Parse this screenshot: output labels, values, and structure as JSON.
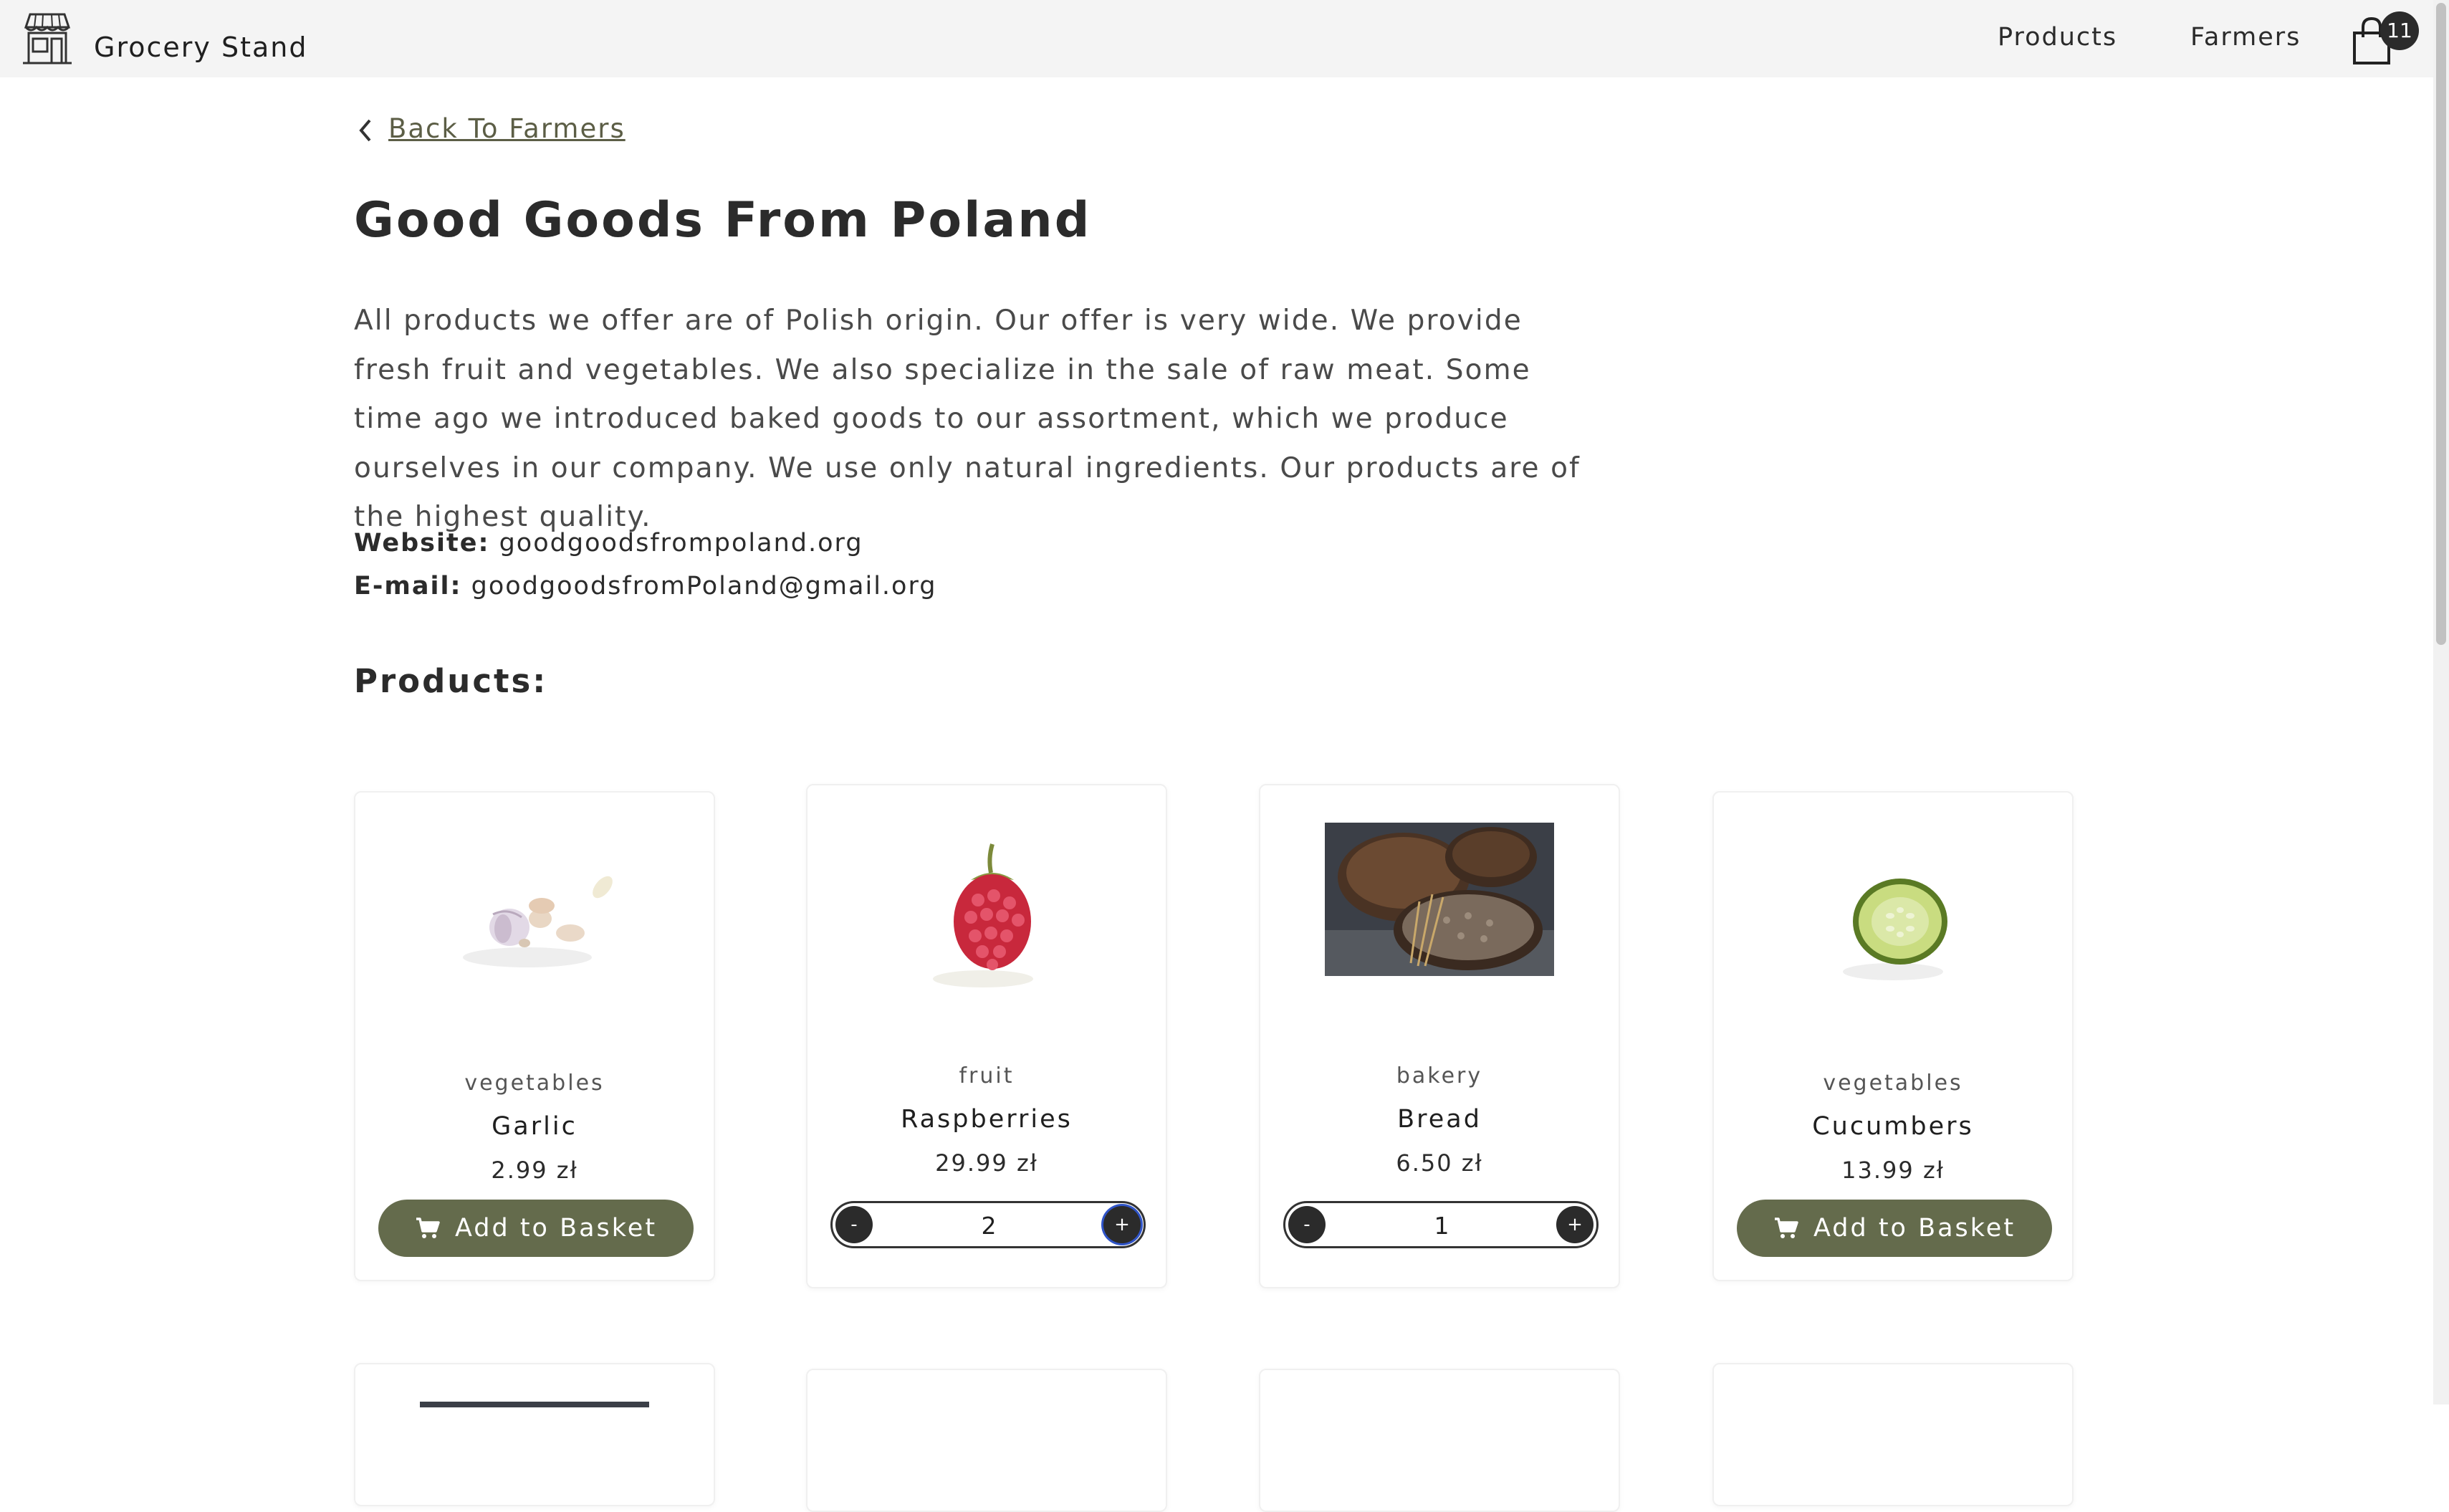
{
  "header": {
    "brand": "Grocery Stand",
    "nav": {
      "products": "Products",
      "farmers": "Farmers"
    },
    "cart_count": "11"
  },
  "back_link": "Back To Farmers",
  "farmer": {
    "title": "Good Goods From Poland",
    "description": "All products we offer are of Polish origin. Our offer is very wide. We provide fresh fruit and vegetables. We also specialize in the sale of raw meat. Some time ago we introduced baked goods to our assortment, which we produce ourselves in our company. We use only natural ingredients. Our products are of the highest quality.",
    "website_label": "Website:",
    "website": "goodgoodsfrompoland.org",
    "email_label": "E-mail:",
    "email": "goodgoodsfromPoland@gmail.org"
  },
  "products_heading": "Products:",
  "products": [
    {
      "category": "vegetables",
      "name": "Garlic",
      "price": "2.99 zł",
      "action": "Add to Basket",
      "image": "garlic-image"
    },
    {
      "category": "fruit",
      "name": "Raspberries",
      "price": "29.99 zł",
      "quantity": "2",
      "image": "raspberry-image"
    },
    {
      "category": "bakery",
      "name": "Bread",
      "price": "6.50 zł",
      "quantity": "1",
      "image": "bread-image"
    },
    {
      "category": "vegetables",
      "name": "Cucumbers",
      "price": "13.99 zł",
      "action": "Add to Basket",
      "image": "cucumber-image"
    }
  ],
  "stepper": {
    "minus": "-",
    "plus": "+"
  },
  "colors": {
    "header_bg": "#f4f4f4",
    "button": "#646b4c",
    "link": "#5c5e46",
    "text": "#2b2b2b"
  }
}
